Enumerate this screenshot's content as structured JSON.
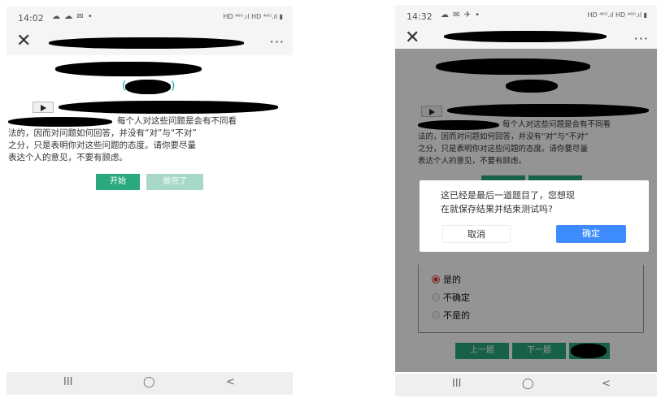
{
  "left_screen": {
    "status": {
      "time": "14:02",
      "notif_icons": "☁ ☁ ✉ •",
      "right_icons": "HD ⁴⁶ᴳ.ıl HD ⁴⁶ᴳ.ıl ▮"
    },
    "appbar": {
      "close_icon": "✕",
      "more_icon": "···"
    },
    "intro_lines": [
      "每个人对这些问题是会有不同看",
      "法的，因而对问题如何回答，并没有“对”与“不对”",
      "之分，只是表明你对这些问题的态度。请你要尽量",
      "表达个人的意见，不要有顾虑。"
    ],
    "buttons": {
      "start": "开始",
      "done": "做完了"
    },
    "navbar": {
      "recent": "III",
      "home": "◯",
      "back": "<"
    }
  },
  "right_screen": {
    "status": {
      "time": "14:32",
      "notif_icons": "☁ ✉ ✈ •",
      "right_icons": "HD ⁴⁶ᴳ.ıl HD ⁴⁶ᴳ.ıl ▮"
    },
    "appbar": {
      "close_icon": "✕",
      "more_icon": "···"
    },
    "intro_lines": [
      "每个人对这些问题是会有不同看",
      "法的，因而对问题如何回答，并没有“对”与“不对”",
      "之分，只是表明你对这些问题的态度。请你要尽量",
      "表达个人的意见，不要有顾虑。"
    ],
    "dialog": {
      "message_lines": [
        "这已经是最后一道题目了，您想现",
        "在就保存结果并结束测试吗?"
      ],
      "cancel": "取消",
      "confirm": "确定"
    },
    "options": [
      {
        "label": "是的",
        "selected": true
      },
      {
        "label": "不确定",
        "selected": false
      },
      {
        "label": "不是的",
        "selected": false
      }
    ],
    "buttons": {
      "prev": "上一题",
      "next": "下一题"
    },
    "navbar": {
      "recent": "III",
      "home": "◯",
      "back": "<"
    }
  },
  "colors": {
    "primary_green": "#2aa87e",
    "confirm_blue": "#3d8bfd",
    "radio_selected": "#e53935"
  }
}
